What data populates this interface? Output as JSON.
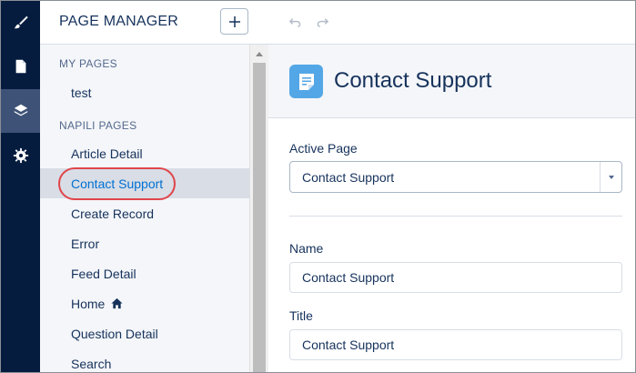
{
  "rail": {
    "icons": [
      "brush-icon",
      "page-icon",
      "layers-icon",
      "gear-icon"
    ],
    "active_index": 2,
    "colors": {
      "background": "#061c3f",
      "active": "#3e5277",
      "icon": "#ffffff"
    }
  },
  "page_manager": {
    "title": "PAGE MANAGER",
    "add_label": "+",
    "my_pages_label": "MY PAGES",
    "my_pages": [
      {
        "label": "test"
      }
    ],
    "napili_label": "NAPILI PAGES",
    "napili_pages": [
      {
        "label": "Article Detail"
      },
      {
        "label": "Contact Support",
        "selected": true
      },
      {
        "label": "Create Record"
      },
      {
        "label": "Error"
      },
      {
        "label": "Feed Detail"
      },
      {
        "label": "Home",
        "icon": "home-icon"
      },
      {
        "label": "Question Detail"
      },
      {
        "label": "Search"
      }
    ]
  },
  "toolbar": {
    "undo_icon": "undo-icon",
    "redo_icon": "redo-icon"
  },
  "page_header": {
    "icon": "document-icon",
    "title": "Contact Support"
  },
  "properties": {
    "active_page_label": "Active Page",
    "active_page_value": "Contact Support",
    "name_label": "Name",
    "name_value": "Contact Support",
    "title_label": "Title",
    "title_value": "Contact Support"
  },
  "colors": {
    "text": "#16325c",
    "link": "#0070d2",
    "highlight_ring": "#e0454a",
    "page_icon": "#54a7e6"
  }
}
